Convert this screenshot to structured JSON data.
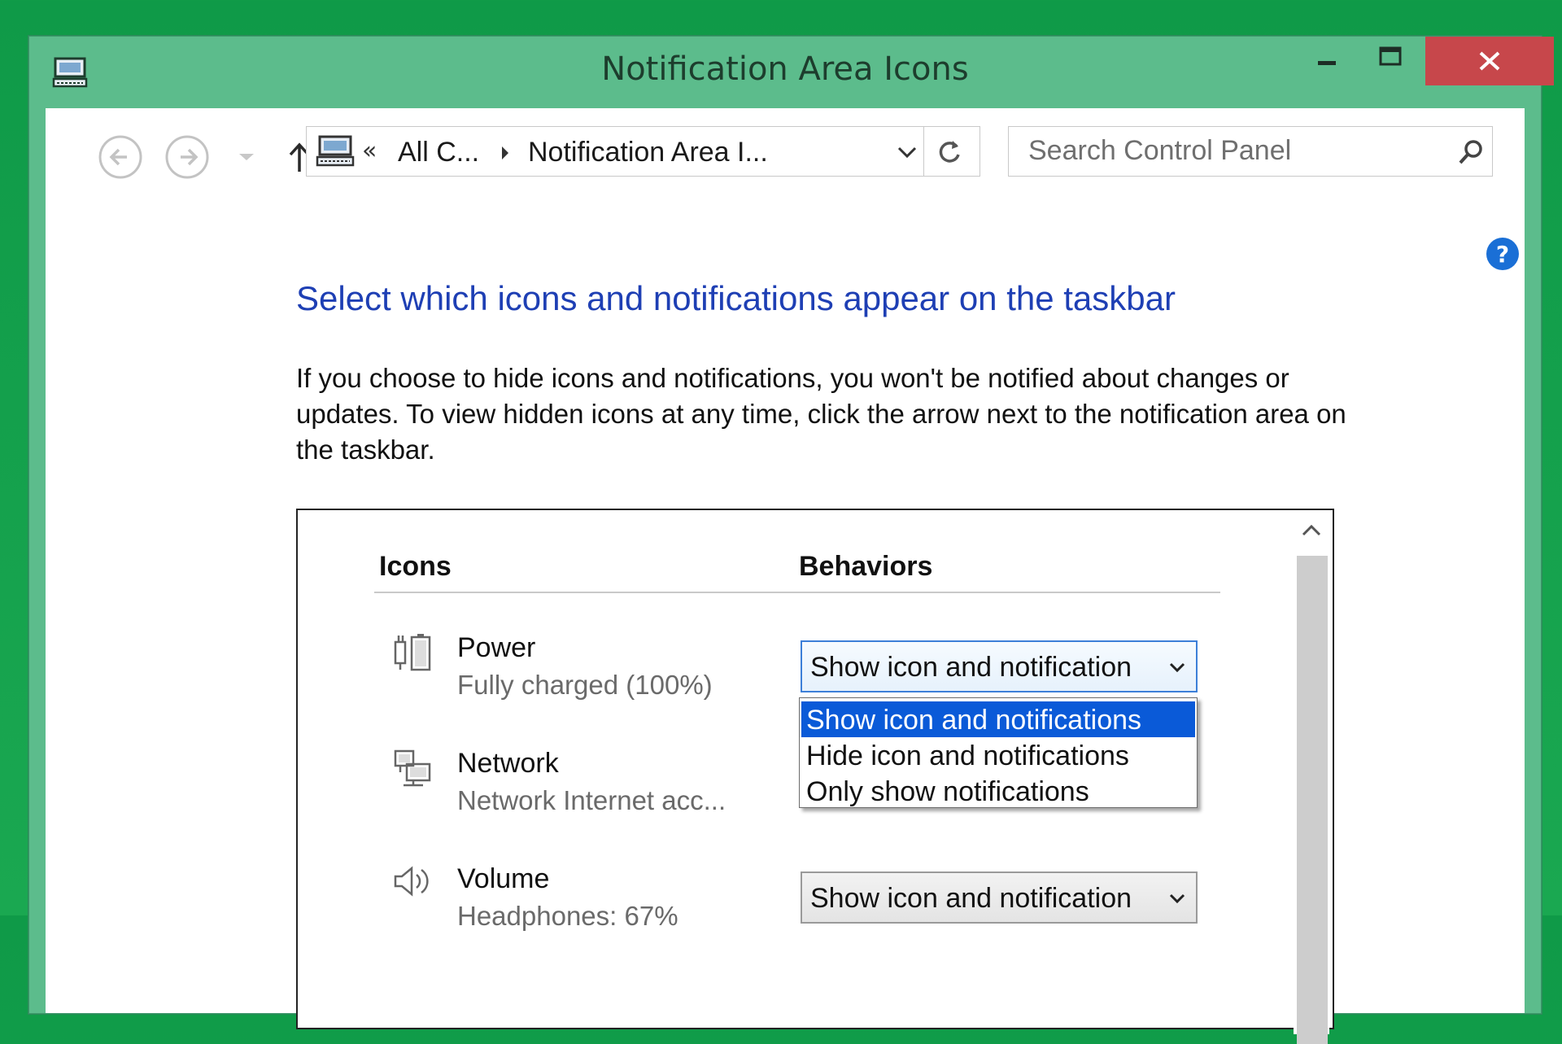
{
  "window": {
    "title": "Notification Area Icons"
  },
  "nav": {
    "breadcrumb_prefix": "«",
    "breadcrumb_root": "All C...",
    "breadcrumb_current": "Notification Area I...",
    "search_placeholder": "Search Control Panel"
  },
  "main": {
    "heading": "Select which icons and notifications appear on the taskbar",
    "description": "If you choose to hide icons and notifications, you won't be notified about changes or updates. To view hidden icons at any time, click the arrow next to the notification area on the taskbar."
  },
  "table": {
    "col_icons": "Icons",
    "col_behaviors": "Behaviors",
    "rows": [
      {
        "name": "Power",
        "status": "Fully charged (100%)",
        "behavior": "Show icon and notification",
        "icon": "power-icon"
      },
      {
        "name": "Network",
        "status": "Network Internet acc...",
        "behavior": "",
        "icon": "network-icon"
      },
      {
        "name": "Volume",
        "status": "Headphones: 67%",
        "behavior": "Show icon and notification",
        "icon": "volume-icon"
      }
    ]
  },
  "dropdown": {
    "options": [
      "Show icon and notifications",
      "Hide icon and notifications",
      "Only show notifications"
    ],
    "selected_index": 0
  },
  "colors": {
    "desktop": "#0f9a48",
    "window_frame": "#5cbc8c",
    "close_button": "#c7474b",
    "heading": "#1e3fb4",
    "selection": "#0a5ad8",
    "help": "#1a6fd6"
  }
}
